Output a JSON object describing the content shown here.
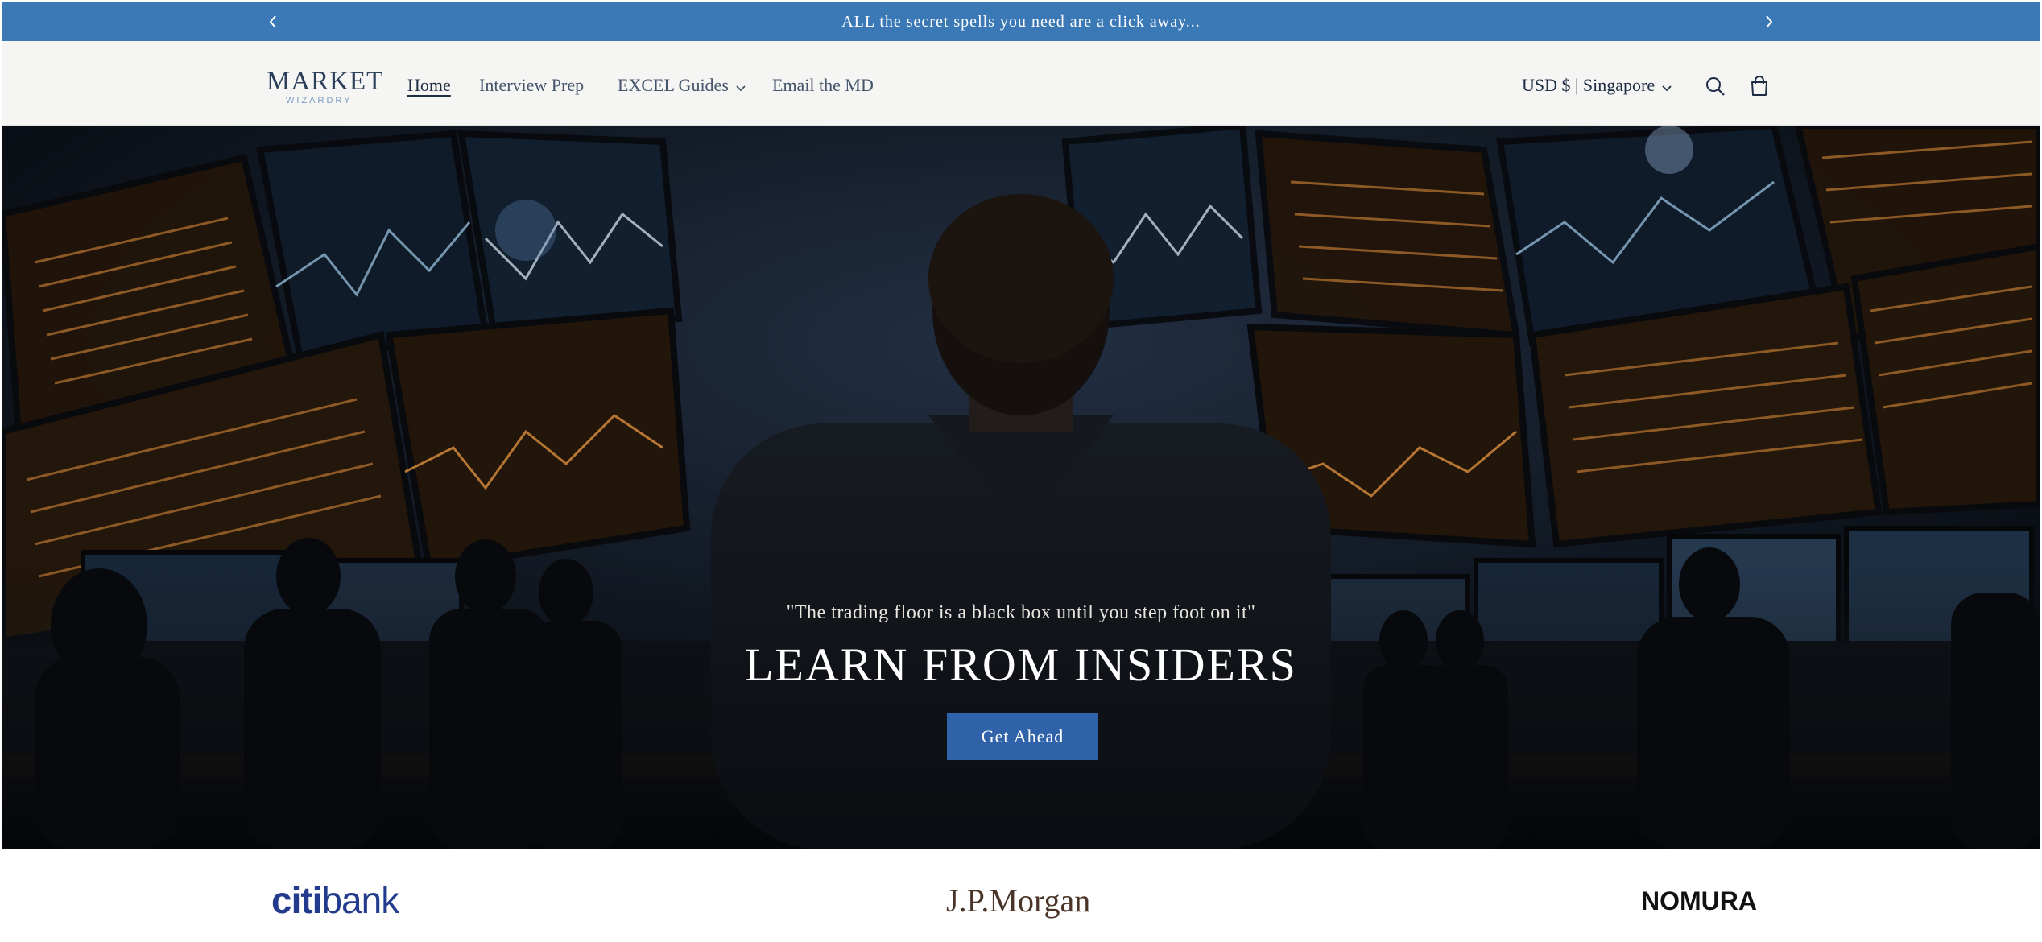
{
  "announcement": {
    "text": "ALL the secret spells you need are a click away...",
    "prev_icon": "chevron-left-icon",
    "next_icon": "chevron-right-icon",
    "background": "#3b79b6"
  },
  "header": {
    "logo": {
      "main": "MARKET",
      "sub": "WIZARDRY"
    },
    "nav": [
      {
        "label": "Home",
        "active": true
      },
      {
        "label": "Interview Prep"
      },
      {
        "label": "EXCEL Guides",
        "has_dropdown": true
      },
      {
        "label": "Email the MD"
      }
    ],
    "currency": "USD $ | Singapore",
    "search_icon": "search-icon",
    "cart_icon": "cart-icon"
  },
  "hero": {
    "quote": "\"The trading floor is a black box until you step foot on it\"",
    "title": "LEARN FROM INSIDERS",
    "button": "Get Ahead",
    "button_color": "#2f62a8"
  },
  "logos": [
    {
      "citi": "citi",
      "bank": "bank"
    },
    {
      "label": "J.P.Morgan"
    },
    {
      "label": "NOMURA"
    }
  ]
}
